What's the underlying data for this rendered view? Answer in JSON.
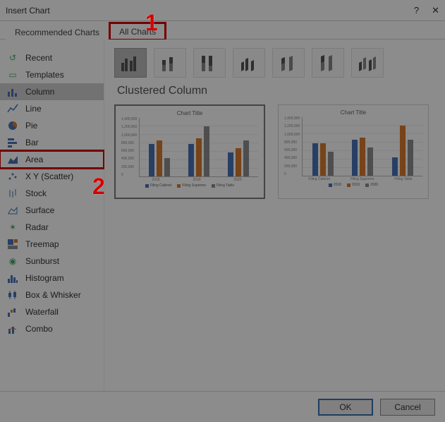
{
  "callouts": {
    "one": "1",
    "two": "2"
  },
  "title": "Insert Chart",
  "help_glyph": "?",
  "close_glyph": "✕",
  "tabs": {
    "recommended": "Recommended Charts",
    "all": "All Charts"
  },
  "sidebar": {
    "items": [
      {
        "label": "Recent"
      },
      {
        "label": "Templates"
      },
      {
        "label": "Column"
      },
      {
        "label": "Line"
      },
      {
        "label": "Pie"
      },
      {
        "label": "Bar"
      },
      {
        "label": "Area"
      },
      {
        "label": "X Y (Scatter)"
      },
      {
        "label": "Stock"
      },
      {
        "label": "Surface"
      },
      {
        "label": "Radar"
      },
      {
        "label": "Treemap"
      },
      {
        "label": "Sunburst"
      },
      {
        "label": "Histogram"
      },
      {
        "label": "Box & Whisker"
      },
      {
        "label": "Waterfall"
      },
      {
        "label": "Combo"
      }
    ]
  },
  "selected_subtype_name": "Clustered Column",
  "preview_title": "Chart Title",
  "colors": {
    "s1": "#4a74b8",
    "s2": "#d97b2e",
    "s3": "#8f8f8f"
  },
  "footer": {
    "ok": "OK",
    "cancel": "Cancel"
  },
  "chart_data": [
    {
      "type": "bar",
      "title": "Chart Title",
      "categories": [
        "2018",
        "2019",
        "2020"
      ],
      "series": [
        {
          "name": "Filing Cabinet",
          "values": [
            800000,
            800000,
            600000
          ]
        },
        {
          "name": "Filing Supreme",
          "values": [
            900000,
            950000,
            700000
          ]
        },
        {
          "name": "Filing Table",
          "values": [
            450000,
            1250000,
            900000
          ]
        }
      ],
      "ylim": [
        0,
        1400000
      ],
      "yticks": [
        "1,400,000",
        "1,200,000",
        "1,000,000",
        "800,000",
        "600,000",
        "400,000",
        "200,000",
        "0"
      ]
    },
    {
      "type": "bar",
      "title": "Chart Title",
      "categories": [
        "Filing Cabinet",
        "Filing Supreme",
        "Filing Table"
      ],
      "series": [
        {
          "name": "2018",
          "values": [
            800000,
            900000,
            450000
          ]
        },
        {
          "name": "2019",
          "values": [
            800000,
            950000,
            1250000
          ]
        },
        {
          "name": "2020",
          "values": [
            600000,
            700000,
            900000
          ]
        }
      ],
      "ylim": [
        0,
        1400000
      ],
      "yticks": [
        "1,400,000",
        "1,200,000",
        "1,000,000",
        "800,000",
        "600,000",
        "400,000",
        "200,000",
        "0"
      ]
    }
  ]
}
